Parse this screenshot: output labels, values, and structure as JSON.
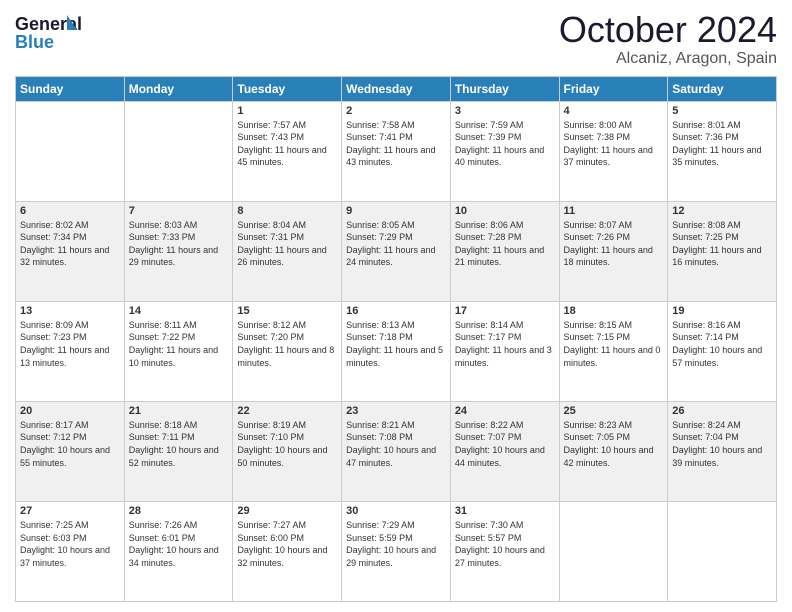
{
  "header": {
    "logo_line1": "General",
    "logo_line2": "Blue",
    "month": "October 2024",
    "location": "Alcaniz, Aragon, Spain"
  },
  "days_of_week": [
    "Sunday",
    "Monday",
    "Tuesday",
    "Wednesday",
    "Thursday",
    "Friday",
    "Saturday"
  ],
  "weeks": [
    {
      "shade": false,
      "days": [
        {
          "num": "",
          "info": ""
        },
        {
          "num": "",
          "info": ""
        },
        {
          "num": "1",
          "info": "Sunrise: 7:57 AM\nSunset: 7:43 PM\nDaylight: 11 hours and 45 minutes."
        },
        {
          "num": "2",
          "info": "Sunrise: 7:58 AM\nSunset: 7:41 PM\nDaylight: 11 hours and 43 minutes."
        },
        {
          "num": "3",
          "info": "Sunrise: 7:59 AM\nSunset: 7:39 PM\nDaylight: 11 hours and 40 minutes."
        },
        {
          "num": "4",
          "info": "Sunrise: 8:00 AM\nSunset: 7:38 PM\nDaylight: 11 hours and 37 minutes."
        },
        {
          "num": "5",
          "info": "Sunrise: 8:01 AM\nSunset: 7:36 PM\nDaylight: 11 hours and 35 minutes."
        }
      ]
    },
    {
      "shade": true,
      "days": [
        {
          "num": "6",
          "info": "Sunrise: 8:02 AM\nSunset: 7:34 PM\nDaylight: 11 hours and 32 minutes."
        },
        {
          "num": "7",
          "info": "Sunrise: 8:03 AM\nSunset: 7:33 PM\nDaylight: 11 hours and 29 minutes."
        },
        {
          "num": "8",
          "info": "Sunrise: 8:04 AM\nSunset: 7:31 PM\nDaylight: 11 hours and 26 minutes."
        },
        {
          "num": "9",
          "info": "Sunrise: 8:05 AM\nSunset: 7:29 PM\nDaylight: 11 hours and 24 minutes."
        },
        {
          "num": "10",
          "info": "Sunrise: 8:06 AM\nSunset: 7:28 PM\nDaylight: 11 hours and 21 minutes."
        },
        {
          "num": "11",
          "info": "Sunrise: 8:07 AM\nSunset: 7:26 PM\nDaylight: 11 hours and 18 minutes."
        },
        {
          "num": "12",
          "info": "Sunrise: 8:08 AM\nSunset: 7:25 PM\nDaylight: 11 hours and 16 minutes."
        }
      ]
    },
    {
      "shade": false,
      "days": [
        {
          "num": "13",
          "info": "Sunrise: 8:09 AM\nSunset: 7:23 PM\nDaylight: 11 hours and 13 minutes."
        },
        {
          "num": "14",
          "info": "Sunrise: 8:11 AM\nSunset: 7:22 PM\nDaylight: 11 hours and 10 minutes."
        },
        {
          "num": "15",
          "info": "Sunrise: 8:12 AM\nSunset: 7:20 PM\nDaylight: 11 hours and 8 minutes."
        },
        {
          "num": "16",
          "info": "Sunrise: 8:13 AM\nSunset: 7:18 PM\nDaylight: 11 hours and 5 minutes."
        },
        {
          "num": "17",
          "info": "Sunrise: 8:14 AM\nSunset: 7:17 PM\nDaylight: 11 hours and 3 minutes."
        },
        {
          "num": "18",
          "info": "Sunrise: 8:15 AM\nSunset: 7:15 PM\nDaylight: 11 hours and 0 minutes."
        },
        {
          "num": "19",
          "info": "Sunrise: 8:16 AM\nSunset: 7:14 PM\nDaylight: 10 hours and 57 minutes."
        }
      ]
    },
    {
      "shade": true,
      "days": [
        {
          "num": "20",
          "info": "Sunrise: 8:17 AM\nSunset: 7:12 PM\nDaylight: 10 hours and 55 minutes."
        },
        {
          "num": "21",
          "info": "Sunrise: 8:18 AM\nSunset: 7:11 PM\nDaylight: 10 hours and 52 minutes."
        },
        {
          "num": "22",
          "info": "Sunrise: 8:19 AM\nSunset: 7:10 PM\nDaylight: 10 hours and 50 minutes."
        },
        {
          "num": "23",
          "info": "Sunrise: 8:21 AM\nSunset: 7:08 PM\nDaylight: 10 hours and 47 minutes."
        },
        {
          "num": "24",
          "info": "Sunrise: 8:22 AM\nSunset: 7:07 PM\nDaylight: 10 hours and 44 minutes."
        },
        {
          "num": "25",
          "info": "Sunrise: 8:23 AM\nSunset: 7:05 PM\nDaylight: 10 hours and 42 minutes."
        },
        {
          "num": "26",
          "info": "Sunrise: 8:24 AM\nSunset: 7:04 PM\nDaylight: 10 hours and 39 minutes."
        }
      ]
    },
    {
      "shade": false,
      "days": [
        {
          "num": "27",
          "info": "Sunrise: 7:25 AM\nSunset: 6:03 PM\nDaylight: 10 hours and 37 minutes."
        },
        {
          "num": "28",
          "info": "Sunrise: 7:26 AM\nSunset: 6:01 PM\nDaylight: 10 hours and 34 minutes."
        },
        {
          "num": "29",
          "info": "Sunrise: 7:27 AM\nSunset: 6:00 PM\nDaylight: 10 hours and 32 minutes."
        },
        {
          "num": "30",
          "info": "Sunrise: 7:29 AM\nSunset: 5:59 PM\nDaylight: 10 hours and 29 minutes."
        },
        {
          "num": "31",
          "info": "Sunrise: 7:30 AM\nSunset: 5:57 PM\nDaylight: 10 hours and 27 minutes."
        },
        {
          "num": "",
          "info": ""
        },
        {
          "num": "",
          "info": ""
        }
      ]
    }
  ]
}
